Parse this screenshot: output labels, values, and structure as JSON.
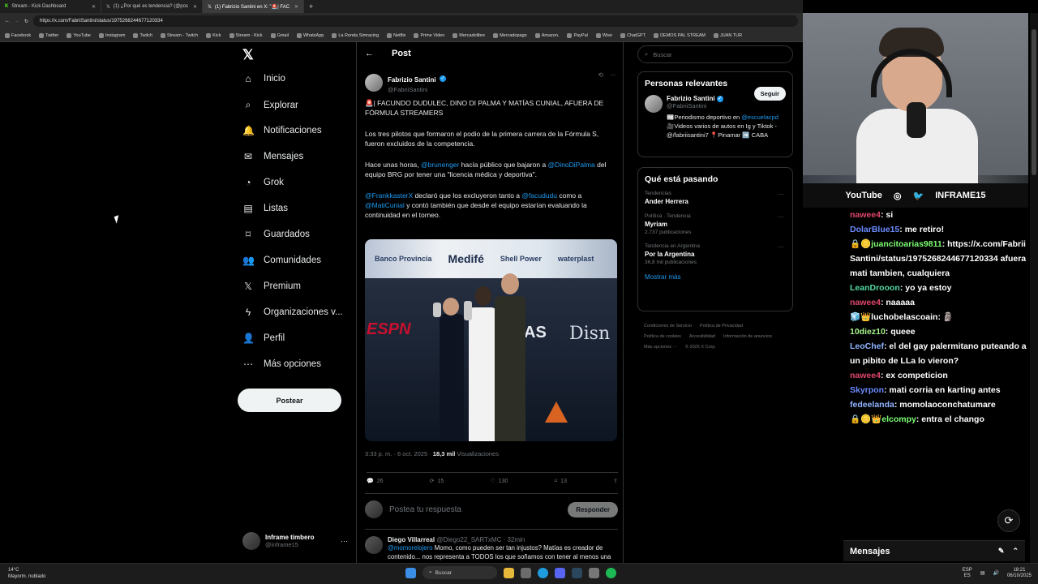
{
  "browser": {
    "tabs": [
      {
        "label": "Stream - Kick Dashboard",
        "icon": "kick-icon"
      },
      {
        "label": "(1) ¿Por qué es tendencia? (@pos",
        "icon": "x-icon"
      },
      {
        "label": "(1) Fabrizio Santini en X: \"🚨| FAC",
        "icon": "x-icon"
      }
    ],
    "url": "https://x.com/FabriiSantini/status/1975268244677120334",
    "bookmarks": [
      "Facebook",
      "Twitter",
      "YouTube",
      "Instagram",
      "Twitch",
      "Stream - Twitch",
      "Kick",
      "Stream - Kick",
      "Gmail",
      "WhatsApp",
      "La Ronda Simracing",
      "Netflix",
      "Prime Video",
      "Mercadolibre",
      "Mercadopago",
      "Amazon.",
      "PayPal",
      "Wise",
      "ChatGPT",
      "DEMOS PAL STREAM",
      "JUAN TUR"
    ]
  },
  "nav": {
    "items": [
      {
        "label": "Inicio",
        "icon": "home-icon"
      },
      {
        "label": "Explorar",
        "icon": "search-icon"
      },
      {
        "label": "Notificaciones",
        "icon": "bell-icon"
      },
      {
        "label": "Mensajes",
        "icon": "mail-icon"
      },
      {
        "label": "Grok",
        "icon": "grok-icon"
      },
      {
        "label": "Listas",
        "icon": "list-icon"
      },
      {
        "label": "Guardados",
        "icon": "bookmark-icon"
      },
      {
        "label": "Comunidades",
        "icon": "people-icon"
      },
      {
        "label": "Premium",
        "icon": "x-icon"
      },
      {
        "label": "Organizaciones v...",
        "icon": "lightning-icon"
      },
      {
        "label": "Perfil",
        "icon": "person-icon"
      },
      {
        "label": "Más opciones",
        "icon": "more-icon"
      }
    ],
    "post_button": "Postear",
    "profile": {
      "name": "Inframe timbero",
      "handle": "@inframe15"
    }
  },
  "feed": {
    "title": "Post",
    "tweet": {
      "author": "Fabrizio Santini",
      "handle": "@FabriiSantini",
      "p1": "🚨| FACUNDO DUDULEC, DINO DI PALMA Y MATÍAS CUNIAL, AFUERA DE FÓRMULA STREAMERS",
      "p2": "Los tres pilotos que formaron el podio de la primera carrera de la Fórmula S, fueron excluidos de la competencia.",
      "p3_a": "Hace unas horas, ",
      "p3_m1": "@brunenger",
      "p3_b": " hacía público que bajaron a ",
      "p3_m2": "@DinoDiPalma",
      "p3_c": " del equipo BRG por tener una \"licencia médica y deportiva\".",
      "p4_m1": "@FrankkasterX",
      "p4_a": " declaró que los excluyeron tanto a ",
      "p4_m2": "@facududu",
      "p4_b": " como a ",
      "p4_m3": "@MatiCunial",
      "p4_c": " y contó también que desde el equipo estarían evaluando la continuidad en el torneo.",
      "media_texts": {
        "brand1": "Banco Provincia",
        "brand2": "Medifé",
        "brand3": "Shell Power",
        "brand4": "waterplast",
        "espn": "ESPN",
        "disney": "Disn",
        "tc": "AS"
      },
      "time": "3:33 p. m. · 6 oct. 2025 · ",
      "views": "18,3 mil",
      "views_label": " Visualizaciones",
      "replies": "26",
      "reposts": "15",
      "likes": "130",
      "bookmarks": "13"
    },
    "reply_placeholder": "Postea tu respuesta",
    "reply_button": "Responder",
    "reply2": {
      "author": "Diego Villarreal",
      "handle": "@Diego22_SARTxMC · 32min",
      "mention": "@momorelojero",
      "text": " Momo, como pueden ser tan injustos? Matías es creador de contenido... nos representa a TODOS los que soñamos con tener al menos una mínima chance de subir a un karting a correr. Están errados acá"
    }
  },
  "right": {
    "search_placeholder": "Buscar",
    "relevant_title": "Personas relevantes",
    "person": {
      "name": "Fabrizio Santini",
      "handle": "@FabriiSantini",
      "follow": "Seguir",
      "bio_a": "📰Periodismo deportivo en ",
      "bio_m": "@escuelacpd",
      "bio_b": " 🎥Videos varios de autos en Ig y Tiktok - @/fabriisantini7 📍Pinamar ➡️ CABA"
    },
    "trending_title": "Qué está pasando",
    "trends": [
      {
        "ctx": "Tendencias",
        "name": "Ander Herrera",
        "count": ""
      },
      {
        "ctx": "Política · Tendencia",
        "name": "Myriam",
        "count": "2.737 publicaciones"
      },
      {
        "ctx": "Tendencia en Argentina",
        "name": "Por la Argentina",
        "count": "36,8 mil publicaciones"
      }
    ],
    "show_more": "Mostrar más",
    "footer": [
      "Condiciones de Servicio",
      "Política de Privacidad",
      "Política de cookies",
      "Accesibilidad",
      "Información de anuncios",
      "Más opciones ···",
      "© 2025 X Corp."
    ]
  },
  "cam": {
    "bar": [
      "YouTube",
      "INFRAME15"
    ]
  },
  "chat": {
    "messages": [
      {
        "user": "nawee4",
        "color": "#e0476c",
        "text": ": si"
      },
      {
        "user": "DolarBlue15",
        "color": "#6b8cff",
        "text": ": me retiro!"
      },
      {
        "user": "juancitoarias9811",
        "color": "#7cfc72",
        "text": ": https://x.com/FabriiSantini/status/1975268244677120334 afuera mati tambien, cualquiera",
        "badges": "🔒🪙"
      },
      {
        "user": "LeanDrooon",
        "color": "#53d9a0",
        "text": ": yo ya estoy"
      },
      {
        "user": "nawee4",
        "color": "#e0476c",
        "text": ": naaaaa"
      },
      {
        "user": "luchobelascoain",
        "color": "#ffffff",
        "text": ": 🗿",
        "badges": "🧊👑"
      },
      {
        "user": "10diez10",
        "color": "#a6f28a",
        "text": ": queee"
      },
      {
        "user": "LeoChef",
        "color": "#8fb3ff",
        "text": ": el del gay palermitano puteando a un pibito de LLa lo vieron?"
      },
      {
        "user": "nawee4",
        "color": "#e0476c",
        "text": ": ex competicion"
      },
      {
        "user": "Skyrpon",
        "color": "#6b8cff",
        "text": ": mati corria en karting antes"
      },
      {
        "user": "fedeelanda",
        "color": "#8fb3ff",
        "text": ": momolaoconchatumare"
      },
      {
        "user": "elcompy",
        "color": "#7cfc72",
        "text": ": entra el chango",
        "badges": "🔒🪙👑"
      }
    ],
    "header": "Mensajes"
  },
  "taskbar": {
    "temp": "14°C",
    "weather": "Mayorm. nublado",
    "search": "Buscar",
    "lang": "ESP",
    "lang2": "ES",
    "time": "18:21",
    "date": "06/10/2025"
  }
}
